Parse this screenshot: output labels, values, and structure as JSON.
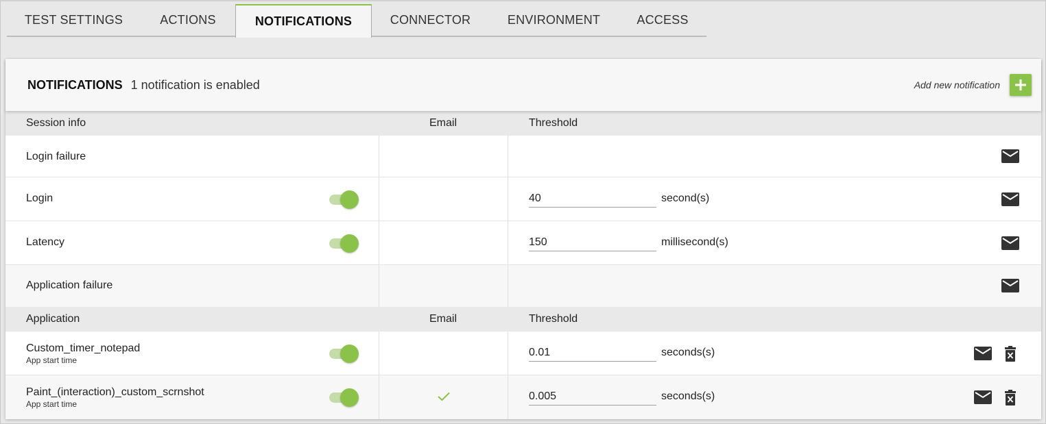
{
  "tabs": [
    {
      "label": "TEST SETTINGS",
      "active": false
    },
    {
      "label": "ACTIONS",
      "active": false
    },
    {
      "label": "NOTIFICATIONS",
      "active": true
    },
    {
      "label": "CONNECTOR",
      "active": false
    },
    {
      "label": "ENVIRONMENT",
      "active": false
    },
    {
      "label": "ACCESS",
      "active": false
    }
  ],
  "header": {
    "title": "NOTIFICATIONS",
    "subtitle": "1 notification is enabled",
    "add_label": "Add new notification",
    "add_icon": "plus-icon"
  },
  "session_section": {
    "col_name": "Session info",
    "col_email": "Email",
    "col_threshold": "Threshold",
    "rows": [
      {
        "name": "Login failure",
        "toggle": null,
        "email_checked": false,
        "threshold": null,
        "unit": null
      },
      {
        "name": "Login",
        "toggle": true,
        "email_checked": false,
        "threshold": "40",
        "unit": "second(s)"
      },
      {
        "name": "Latency",
        "toggle": true,
        "email_checked": false,
        "threshold": "150",
        "unit": "millisecond(s)"
      },
      {
        "name": "Application failure",
        "toggle": null,
        "email_checked": false,
        "threshold": null,
        "unit": null
      }
    ]
  },
  "application_section": {
    "col_name": "Application",
    "col_email": "Email",
    "col_threshold": "Threshold",
    "rows": [
      {
        "name": "Custom_timer_notepad",
        "sub": "App start time",
        "toggle": true,
        "email_checked": false,
        "threshold": "0.01",
        "unit": "seconds(s)"
      },
      {
        "name": "Paint_(interaction)_custom_scrnshot",
        "sub": "App start time",
        "toggle": true,
        "email_checked": true,
        "threshold": "0.005",
        "unit": "seconds(s)"
      }
    ]
  },
  "icons": {
    "mail": "envelope-icon",
    "delete": "trash-icon",
    "check": "checkmark-icon"
  },
  "colors": {
    "accent": "#8bc34a",
    "toggle_track": "#c5dca9",
    "icon": "#333333"
  }
}
